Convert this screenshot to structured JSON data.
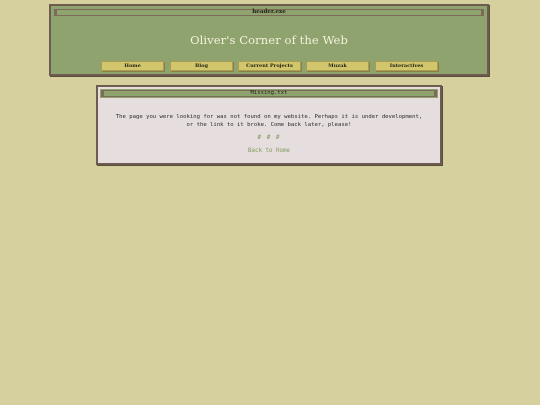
{
  "header": {
    "window_title": "header.exe",
    "site_title": "Oliver's Corner of the Web",
    "nav": [
      {
        "label": "Home"
      },
      {
        "label": "Blog"
      },
      {
        "label": "Current Projects"
      },
      {
        "label": "Muzak"
      },
      {
        "label": "Interactives"
      }
    ]
  },
  "content": {
    "window_title": "Missing.txt",
    "message_line1": "The page you were looking for was not found on my website. Perhaps it is under development,",
    "message_line2": "or the link to it broke. Come back later, please!",
    "separator": "# # #",
    "back_link": "Back to Home"
  },
  "colors": {
    "background": "#d6d09e",
    "header_bg": "#8fa36f",
    "border": "#6e5d4e",
    "nav_button": "#d1c66b",
    "content_bg": "#e6dede",
    "link": "#7f9a5a"
  }
}
